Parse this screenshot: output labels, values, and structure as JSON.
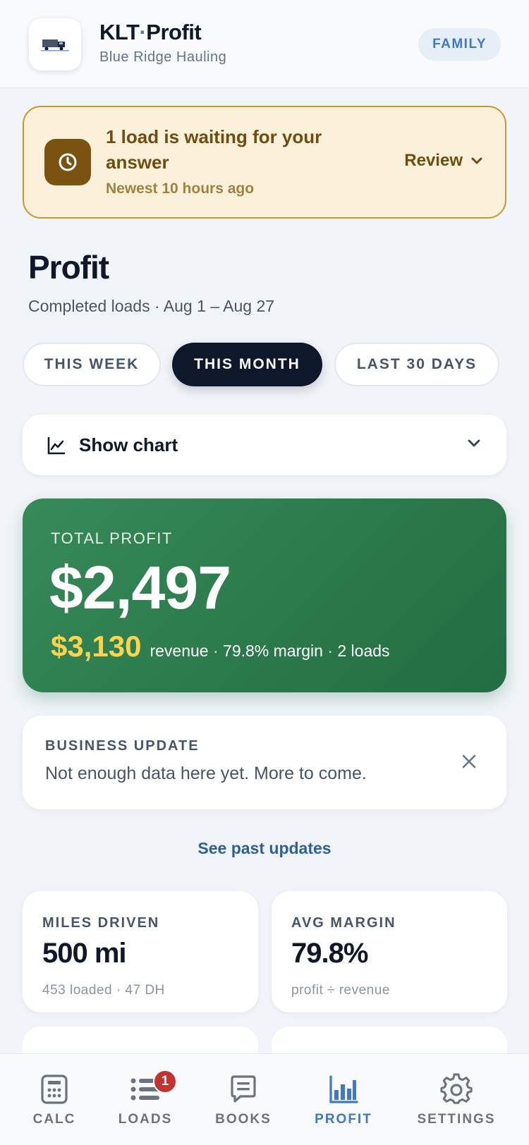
{
  "header": {
    "title_part1": "KLT",
    "title_sep": "·",
    "title_part2": "Profit",
    "subtitle": "Blue Ridge Hauling",
    "plan_badge": "FAMILY"
  },
  "alert": {
    "title": "1 load is waiting for your answer",
    "subtitle": "Newest 10 hours ago",
    "action_label": "Review",
    "icon": "clock-icon"
  },
  "page": {
    "title": "Profit",
    "subtitle": "Completed loads · Aug 1 – Aug 27"
  },
  "ranges": [
    {
      "label": "THIS WEEK",
      "selected": false
    },
    {
      "label": "THIS MONTH",
      "selected": true
    },
    {
      "label": "LAST 30 DAYS",
      "selected": false
    }
  ],
  "chart_toggle": {
    "label": "Show chart",
    "icon": "line-chart-icon"
  },
  "profit_card": {
    "label": "TOTAL PROFIT",
    "amount": "$2,497",
    "revenue": "$3,130",
    "details": "revenue · 79.8% margin · 2 loads"
  },
  "business_update": {
    "label": "BUSINESS UPDATE",
    "text": "Not enough data here yet. More to come."
  },
  "past_updates_link": "See past updates",
  "stats": [
    {
      "label": "MILES DRIVEN",
      "value": "500 mi",
      "sub": "453 loaded · 47 DH"
    },
    {
      "label": "AVG MARGIN",
      "value": "79.8%",
      "sub": "profit ÷ revenue"
    }
  ],
  "nav": [
    {
      "label": "CALC",
      "icon": "calculator-icon",
      "active": false
    },
    {
      "label": "LOADS",
      "icon": "list-icon",
      "active": false,
      "badge": "1"
    },
    {
      "label": "BOOKS",
      "icon": "ledger-icon",
      "active": false
    },
    {
      "label": "PROFIT",
      "icon": "bar-chart-icon",
      "active": true
    },
    {
      "label": "SETTINGS",
      "icon": "gear-icon",
      "active": false
    }
  ],
  "colors": {
    "accent": "#3f79c5",
    "profit_green": "#2b7a4b",
    "revenue_yellow": "#fcd34d",
    "alert_bg": "#fbf0d9",
    "alert_brown": "#7a5310",
    "nav_badge": "#c43131"
  }
}
